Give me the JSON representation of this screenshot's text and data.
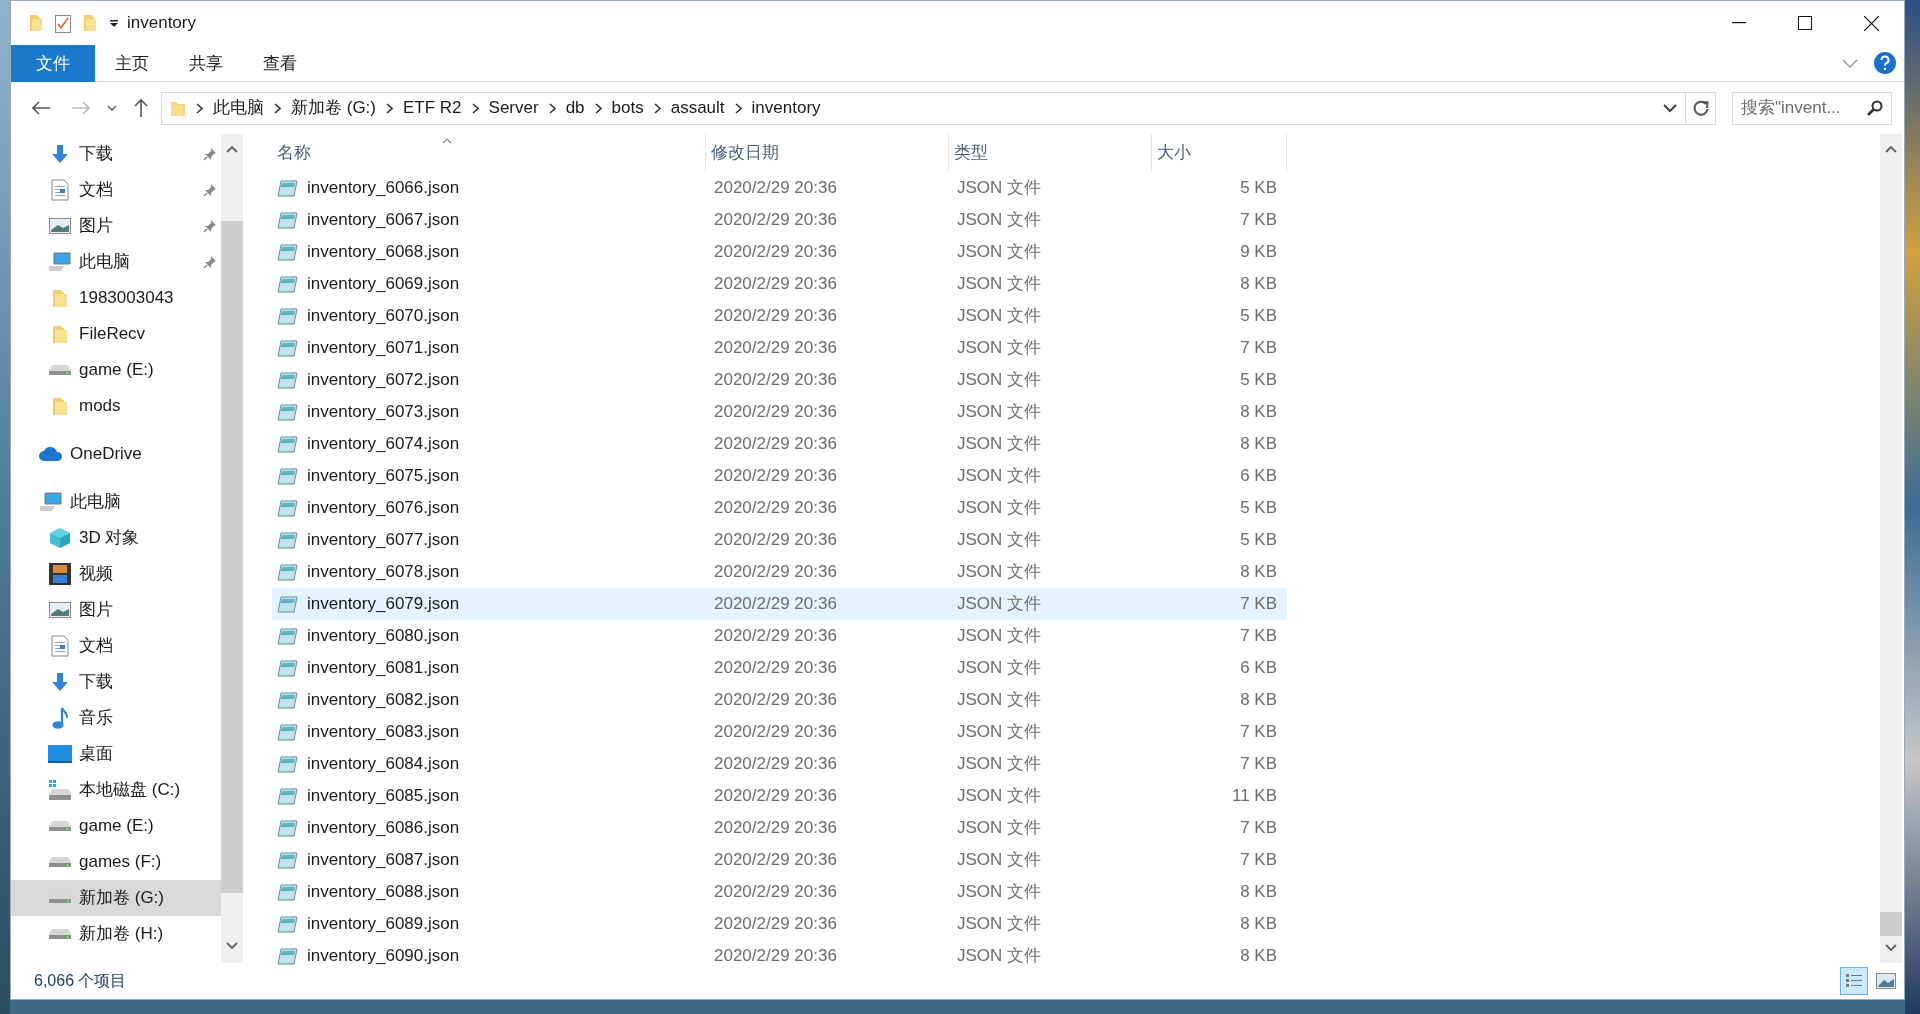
{
  "window": {
    "title": "inventory"
  },
  "ribbon_tabs": [
    {
      "label": "文件",
      "selected": true
    },
    {
      "label": "主页",
      "selected": false
    },
    {
      "label": "共享",
      "selected": false
    },
    {
      "label": "查看",
      "selected": false
    }
  ],
  "breadcrumb": [
    "此电脑",
    "新加卷 (G:)",
    "ETF R2",
    "Server",
    "db",
    "bots",
    "assault",
    "inventory"
  ],
  "search": {
    "placeholder": "搜索\"invent..."
  },
  "sidebar": {
    "quick_access": [
      {
        "label": "下载",
        "kind": "download",
        "pinned": true
      },
      {
        "label": "文档",
        "kind": "document",
        "pinned": true
      },
      {
        "label": "图片",
        "kind": "pictures",
        "pinned": true
      },
      {
        "label": "此电脑",
        "kind": "computer",
        "pinned": true
      },
      {
        "label": "1983003043",
        "kind": "folder",
        "pinned": false
      },
      {
        "label": "FileRecv",
        "kind": "folder",
        "pinned": false
      },
      {
        "label": "game (E:)",
        "kind": "drive",
        "pinned": false
      },
      {
        "label": "mods",
        "kind": "folder",
        "pinned": false
      }
    ],
    "onedrive": {
      "label": "OneDrive"
    },
    "this_pc": {
      "label": "此电脑",
      "children": [
        {
          "label": "3D 对象",
          "kind": "cube",
          "selected": false
        },
        {
          "label": "视频",
          "kind": "video",
          "selected": false
        },
        {
          "label": "图片",
          "kind": "pictures",
          "selected": false
        },
        {
          "label": "文档",
          "kind": "document",
          "selected": false
        },
        {
          "label": "下载",
          "kind": "download",
          "selected": false
        },
        {
          "label": "音乐",
          "kind": "music",
          "selected": false
        },
        {
          "label": "桌面",
          "kind": "desktop",
          "selected": false
        },
        {
          "label": "本地磁盘 (C:)",
          "kind": "system_drive",
          "selected": false
        },
        {
          "label": "game (E:)",
          "kind": "drive",
          "selected": false
        },
        {
          "label": "games (F:)",
          "kind": "drive",
          "selected": false
        },
        {
          "label": "新加卷 (G:)",
          "kind": "drive",
          "selected": true
        },
        {
          "label": "新加卷 (H:)",
          "kind": "drive",
          "selected": false
        }
      ]
    }
  },
  "table": {
    "columns": [
      "名称",
      "修改日期",
      "类型",
      "大小"
    ],
    "rows": [
      {
        "name": "inventory_6066.json",
        "date": "2020/2/29 20:36",
        "type": "JSON 文件",
        "size": "5 KB",
        "selected": false
      },
      {
        "name": "inventory_6067.json",
        "date": "2020/2/29 20:36",
        "type": "JSON 文件",
        "size": "7 KB",
        "selected": false
      },
      {
        "name": "inventory_6068.json",
        "date": "2020/2/29 20:36",
        "type": "JSON 文件",
        "size": "9 KB",
        "selected": false
      },
      {
        "name": "inventory_6069.json",
        "date": "2020/2/29 20:36",
        "type": "JSON 文件",
        "size": "8 KB",
        "selected": false
      },
      {
        "name": "inventory_6070.json",
        "date": "2020/2/29 20:36",
        "type": "JSON 文件",
        "size": "5 KB",
        "selected": false
      },
      {
        "name": "inventory_6071.json",
        "date": "2020/2/29 20:36",
        "type": "JSON 文件",
        "size": "7 KB",
        "selected": false
      },
      {
        "name": "inventory_6072.json",
        "date": "2020/2/29 20:36",
        "type": "JSON 文件",
        "size": "5 KB",
        "selected": false
      },
      {
        "name": "inventory_6073.json",
        "date": "2020/2/29 20:36",
        "type": "JSON 文件",
        "size": "8 KB",
        "selected": false
      },
      {
        "name": "inventory_6074.json",
        "date": "2020/2/29 20:36",
        "type": "JSON 文件",
        "size": "8 KB",
        "selected": false
      },
      {
        "name": "inventory_6075.json",
        "date": "2020/2/29 20:36",
        "type": "JSON 文件",
        "size": "6 KB",
        "selected": false
      },
      {
        "name": "inventory_6076.json",
        "date": "2020/2/29 20:36",
        "type": "JSON 文件",
        "size": "5 KB",
        "selected": false
      },
      {
        "name": "inventory_6077.json",
        "date": "2020/2/29 20:36",
        "type": "JSON 文件",
        "size": "5 KB",
        "selected": false
      },
      {
        "name": "inventory_6078.json",
        "date": "2020/2/29 20:36",
        "type": "JSON 文件",
        "size": "8 KB",
        "selected": false
      },
      {
        "name": "inventory_6079.json",
        "date": "2020/2/29 20:36",
        "type": "JSON 文件",
        "size": "7 KB",
        "selected": true
      },
      {
        "name": "inventory_6080.json",
        "date": "2020/2/29 20:36",
        "type": "JSON 文件",
        "size": "7 KB",
        "selected": false
      },
      {
        "name": "inventory_6081.json",
        "date": "2020/2/29 20:36",
        "type": "JSON 文件",
        "size": "6 KB",
        "selected": false
      },
      {
        "name": "inventory_6082.json",
        "date": "2020/2/29 20:36",
        "type": "JSON 文件",
        "size": "8 KB",
        "selected": false
      },
      {
        "name": "inventory_6083.json",
        "date": "2020/2/29 20:36",
        "type": "JSON 文件",
        "size": "7 KB",
        "selected": false
      },
      {
        "name": "inventory_6084.json",
        "date": "2020/2/29 20:36",
        "type": "JSON 文件",
        "size": "7 KB",
        "selected": false
      },
      {
        "name": "inventory_6085.json",
        "date": "2020/2/29 20:36",
        "type": "JSON 文件",
        "size": "11 KB",
        "selected": false
      },
      {
        "name": "inventory_6086.json",
        "date": "2020/2/29 20:36",
        "type": "JSON 文件",
        "size": "7 KB",
        "selected": false
      },
      {
        "name": "inventory_6087.json",
        "date": "2020/2/29 20:36",
        "type": "JSON 文件",
        "size": "7 KB",
        "selected": false
      },
      {
        "name": "inventory_6088.json",
        "date": "2020/2/29 20:36",
        "type": "JSON 文件",
        "size": "8 KB",
        "selected": false
      },
      {
        "name": "inventory_6089.json",
        "date": "2020/2/29 20:36",
        "type": "JSON 文件",
        "size": "8 KB",
        "selected": false
      },
      {
        "name": "inventory_6090.json",
        "date": "2020/2/29 20:36",
        "type": "JSON 文件",
        "size": "8 KB",
        "selected": false
      }
    ]
  },
  "status_bar": {
    "item_count": "6,066 个项目"
  }
}
